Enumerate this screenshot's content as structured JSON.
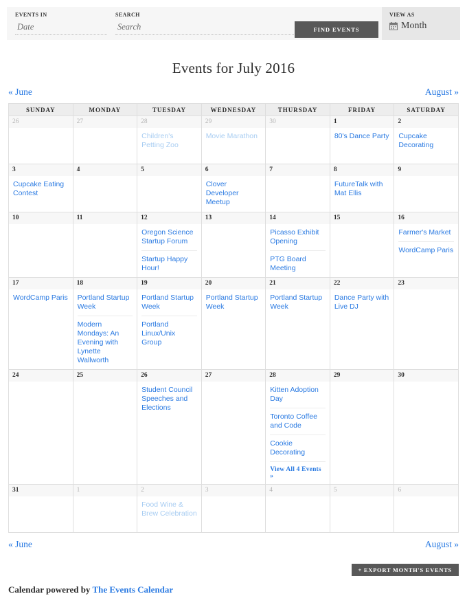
{
  "filter_bar": {
    "events_in": {
      "label": "EVENTS IN",
      "value": "",
      "placeholder": "Date"
    },
    "search": {
      "label": "SEARCH",
      "value": "",
      "placeholder": "Search"
    },
    "find_events_label": "FIND EVENTS",
    "view_as": {
      "label": "VIEW AS",
      "value": "Month",
      "icon": "calendar-icon"
    }
  },
  "header": {
    "title": "Events for July 2016"
  },
  "nav": {
    "prev": "« June",
    "next": "August »"
  },
  "calendar": {
    "weekday_headers": [
      "SUNDAY",
      "MONDAY",
      "TUESDAY",
      "WEDNESDAY",
      "THURSDAY",
      "FRIDAY",
      "SATURDAY"
    ],
    "weeks": [
      [
        {
          "day": "26",
          "in_month": false,
          "events": []
        },
        {
          "day": "27",
          "in_month": false,
          "events": []
        },
        {
          "day": "28",
          "in_month": false,
          "events": [
            "Children's Petting Zoo"
          ]
        },
        {
          "day": "29",
          "in_month": false,
          "events": [
            "Movie Marathon"
          ]
        },
        {
          "day": "30",
          "in_month": false,
          "events": []
        },
        {
          "day": "1",
          "in_month": true,
          "events": [
            "80's Dance Party"
          ]
        },
        {
          "day": "2",
          "in_month": true,
          "events": [
            "Cupcake Decorating"
          ]
        }
      ],
      [
        {
          "day": "3",
          "in_month": true,
          "events": [
            "Cupcake Eating Contest"
          ]
        },
        {
          "day": "4",
          "in_month": true,
          "events": []
        },
        {
          "day": "5",
          "in_month": true,
          "events": []
        },
        {
          "day": "6",
          "in_month": true,
          "events": [
            "Clover Developer Meetup"
          ]
        },
        {
          "day": "7",
          "in_month": true,
          "events": []
        },
        {
          "day": "8",
          "in_month": true,
          "events": [
            "FutureTalk with Mat Ellis"
          ]
        },
        {
          "day": "9",
          "in_month": true,
          "events": []
        }
      ],
      [
        {
          "day": "10",
          "in_month": true,
          "events": []
        },
        {
          "day": "11",
          "in_month": true,
          "events": []
        },
        {
          "day": "12",
          "in_month": true,
          "events": [
            "Oregon Science Startup Forum",
            "Startup Happy Hour!"
          ]
        },
        {
          "day": "13",
          "in_month": true,
          "events": []
        },
        {
          "day": "14",
          "in_month": true,
          "events": [
            "Picasso Exhibit Opening",
            "PTG Board Meeting"
          ]
        },
        {
          "day": "15",
          "in_month": true,
          "events": []
        },
        {
          "day": "16",
          "in_month": true,
          "events": [
            "Farmer's Market",
            "WordCamp Paris"
          ]
        }
      ],
      [
        {
          "day": "17",
          "in_month": true,
          "events": [
            "WordCamp Paris"
          ]
        },
        {
          "day": "18",
          "in_month": true,
          "events": [
            "Portland Startup Week",
            "Modern Mondays: An Evening with Lynette Wallworth"
          ]
        },
        {
          "day": "19",
          "in_month": true,
          "events": [
            "Portland Startup Week",
            "Portland Linux/Unix Group"
          ]
        },
        {
          "day": "20",
          "in_month": true,
          "events": [
            "Portland Startup Week"
          ]
        },
        {
          "day": "21",
          "in_month": true,
          "events": [
            "Portland Startup Week"
          ]
        },
        {
          "day": "22",
          "in_month": true,
          "events": [
            "Dance Party with Live DJ"
          ]
        },
        {
          "day": "23",
          "in_month": true,
          "events": []
        }
      ],
      [
        {
          "day": "24",
          "in_month": true,
          "events": []
        },
        {
          "day": "25",
          "in_month": true,
          "events": []
        },
        {
          "day": "26",
          "in_month": true,
          "events": [
            "Student Council Speeches and Elections"
          ]
        },
        {
          "day": "27",
          "in_month": true,
          "events": []
        },
        {
          "day": "28",
          "in_month": true,
          "events": [
            "Kitten Adoption Day",
            "Toronto Coffee and Code",
            "Cookie Decorating"
          ],
          "view_all": "View All 4 Events »"
        },
        {
          "day": "29",
          "in_month": true,
          "events": []
        },
        {
          "day": "30",
          "in_month": true,
          "events": []
        }
      ],
      [
        {
          "day": "31",
          "in_month": true,
          "events": []
        },
        {
          "day": "1",
          "in_month": false,
          "events": []
        },
        {
          "day": "2",
          "in_month": false,
          "events": [
            "Food Wine & Brew Celebration"
          ]
        },
        {
          "day": "3",
          "in_month": false,
          "events": []
        },
        {
          "day": "4",
          "in_month": false,
          "events": []
        },
        {
          "day": "5",
          "in_month": false,
          "events": []
        },
        {
          "day": "6",
          "in_month": false,
          "events": []
        }
      ]
    ]
  },
  "footer": {
    "export_label": "+ EXPORT MONTH'S EVENTS",
    "credit_prefix": "Calendar powered by ",
    "credit_link": "The Events Calendar"
  },
  "colors": {
    "link_blue": "#2a7ae2",
    "link_blue_muted": "#a8cdf2",
    "button_dark": "#585858",
    "header_gray": "#ededed",
    "filter_gray": "#f6f6f6",
    "viewas_gray": "#e7e7e7",
    "border_gray": "#dedede"
  }
}
